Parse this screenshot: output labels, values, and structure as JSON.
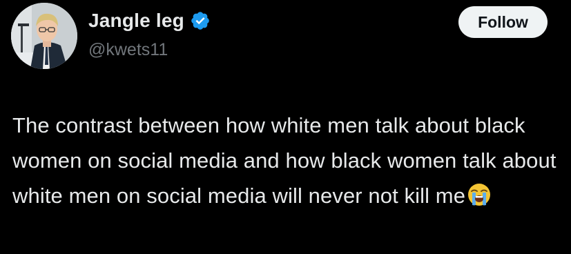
{
  "user": {
    "display_name": "Jangle leg",
    "handle": "@kwets11",
    "verified": true,
    "verified_color": "#1d9bf0"
  },
  "follow_button": {
    "label": "Follow"
  },
  "tweet": {
    "text": "The contrast between how white men talk about black women on social media and how black women talk about white men on social media will never not kill me",
    "emoji": "loudly-crying-face-icon"
  },
  "colors": {
    "background": "#000000",
    "text_primary": "#e7e9ea",
    "text_secondary": "#71767b",
    "button_bg": "#eff3f4",
    "button_text": "#0f1419"
  }
}
